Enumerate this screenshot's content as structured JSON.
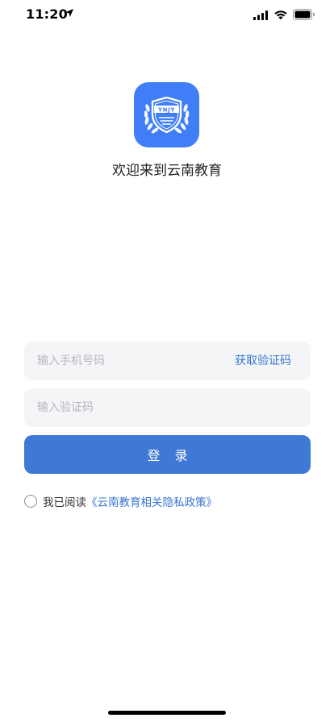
{
  "status_bar": {
    "time": "11:20",
    "icons": [
      "location-arrow-icon",
      "cellular-signal-icon",
      "wifi-icon",
      "battery-icon"
    ]
  },
  "logo": {
    "text": "YNJY",
    "color": "#3f7ef6"
  },
  "welcome": "欢迎来到云南教育",
  "form": {
    "phone_placeholder": "输入手机号码",
    "get_code_label": "获取验证码",
    "code_placeholder": "输入验证码",
    "login_label": "登录"
  },
  "agreement": {
    "checked": false,
    "prefix": "我已阅读",
    "policy_link": "《云南教育相关隐私政策》"
  },
  "colors": {
    "accent": "#3f79d6",
    "link": "#3a75d2",
    "field_bg": "#f4f5f7"
  }
}
